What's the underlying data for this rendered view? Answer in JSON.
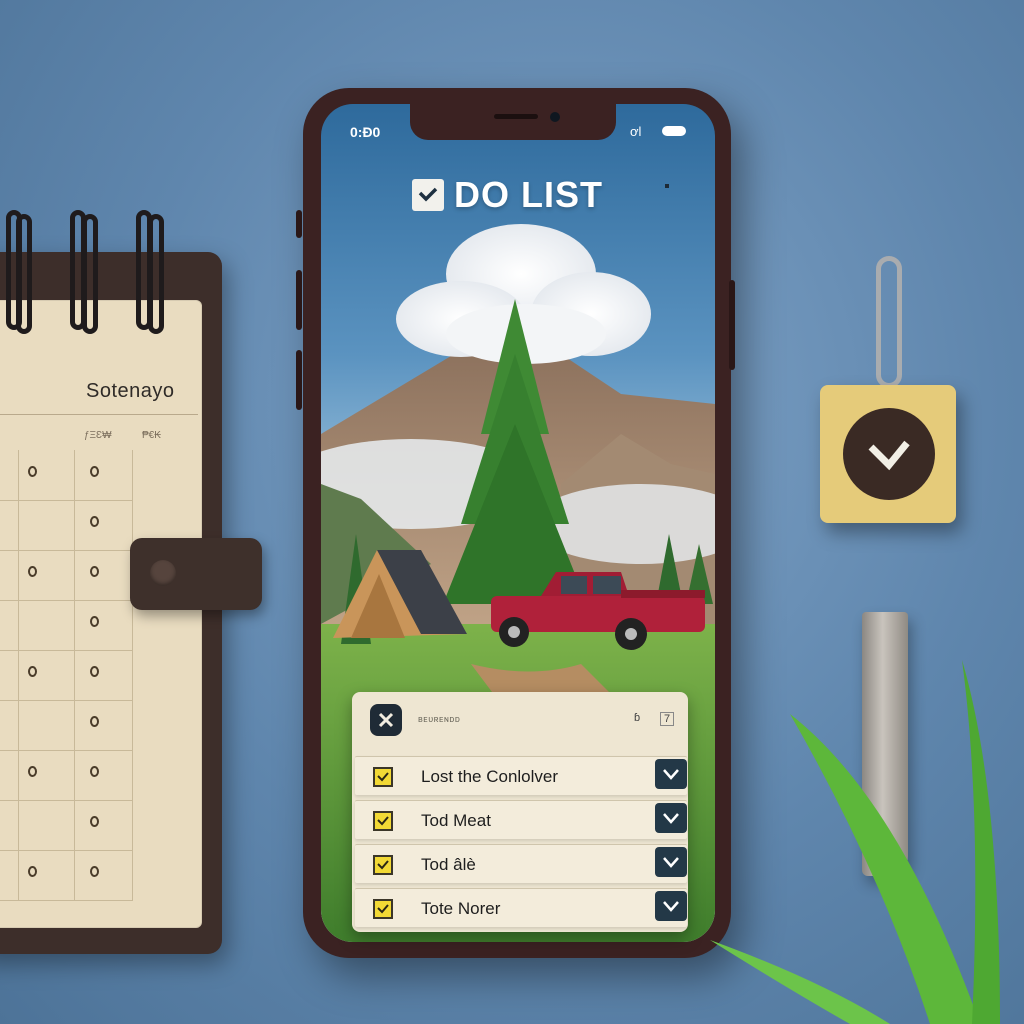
{
  "planner": {
    "title": "Sotenayo",
    "col_heads": [
      "ƒΞƐ₩",
      "₱€₭"
    ]
  },
  "status_bar": {
    "time": "0:Đ0",
    "right": "ơl"
  },
  "app": {
    "title": "DO LIST"
  },
  "task_panel": {
    "tag": "ʙᴇᴜʀᴇɴᴅᴅ",
    "controls": [
      "ɓ",
      "7"
    ],
    "tasks": [
      {
        "label": "Lost the Conlolver",
        "done": true
      },
      {
        "label": "Tod Meat",
        "done": true
      },
      {
        "label": "Tod âlè",
        "done": true
      },
      {
        "label": "Tote Norer",
        "done": true
      }
    ]
  },
  "colors": {
    "accent_check": "#f2d935",
    "done_button": "#233847",
    "panel": "#eee6d2",
    "background": "#5f86ad"
  }
}
